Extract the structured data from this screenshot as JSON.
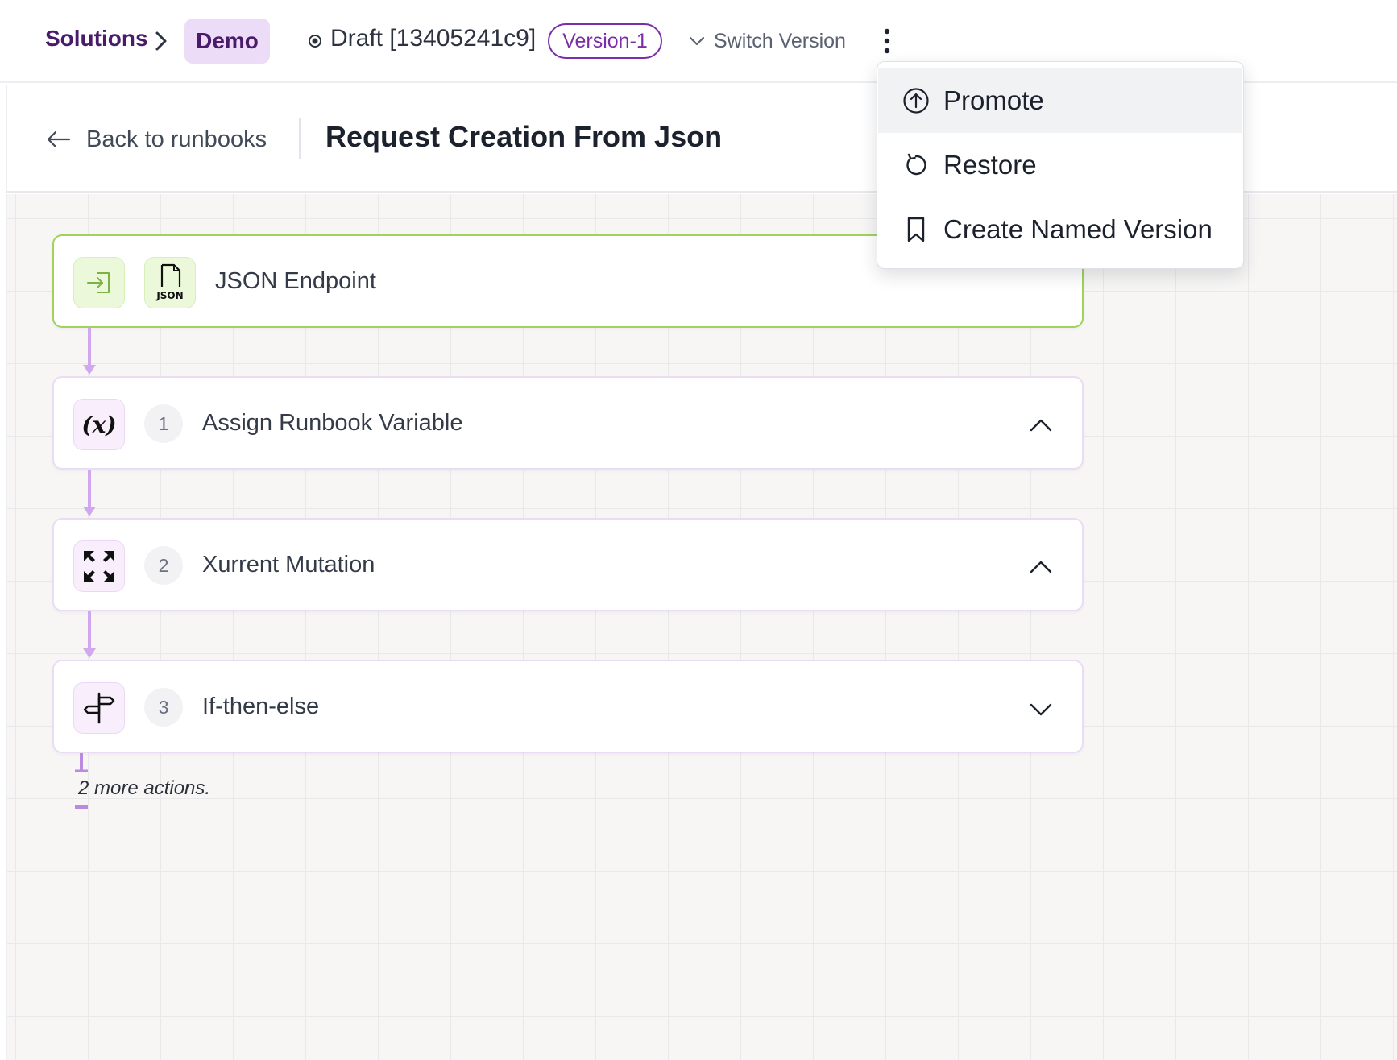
{
  "breadcrumb": {
    "solutions": "Solutions",
    "current": "Demo"
  },
  "version": {
    "draft_label": "Draft [13405241c9]",
    "version_badge": "Version-1",
    "switch_label": "Switch Version"
  },
  "header": {
    "back_label": "Back to runbooks",
    "title": "Request Creation From Json"
  },
  "menu": {
    "items": [
      {
        "label": "Promote",
        "icon": "arrow-up-circle-icon"
      },
      {
        "label": "Restore",
        "icon": "restore-icon"
      },
      {
        "label": "Create Named Version",
        "icon": "bookmark-icon"
      }
    ]
  },
  "flow": {
    "trigger": {
      "label": "JSON Endpoint",
      "icons": [
        "enter-icon",
        "json-file-icon"
      ],
      "json_badge": "JSON"
    },
    "steps": [
      {
        "number": "1",
        "label": "Assign Runbook Variable",
        "icon": "variable-icon",
        "glyph": "(x)",
        "state": "expanded"
      },
      {
        "number": "2",
        "label": "Xurrent Mutation",
        "icon": "xurrent-logo-icon",
        "state": "expanded"
      },
      {
        "number": "3",
        "label": "If-then-else",
        "icon": "signpost-icon",
        "state": "collapsed"
      }
    ],
    "more_actions": "2 more actions."
  },
  "colors": {
    "brand_purple": "#4a1b6b",
    "accent_purple": "#7a2ea8",
    "connector": "#d1a8ef",
    "trigger_border": "#9fd35a"
  }
}
